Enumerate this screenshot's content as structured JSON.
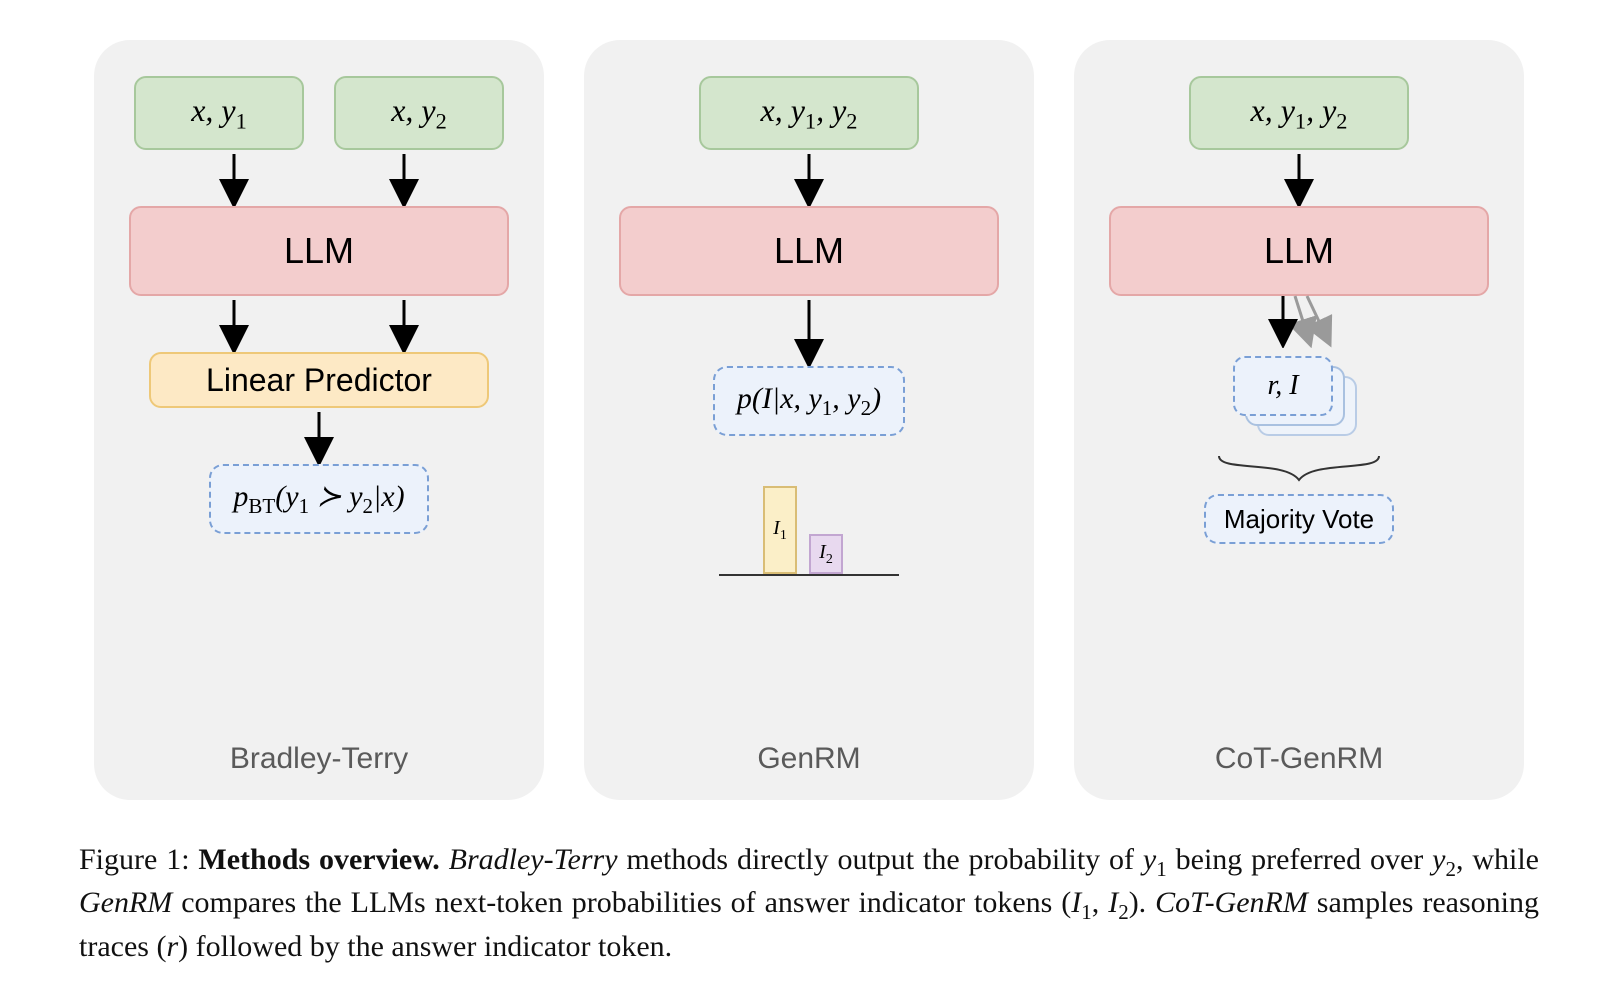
{
  "panels": {
    "bt": {
      "input1_html": "<span class='math'>x, y<sub>1</sub></span>",
      "input2_html": "<span class='math'>x, y<sub>2</sub></span>",
      "llm": "LLM",
      "linear": "Linear Predictor",
      "output_html": "<span class='math'>p<sub>BT</sub>(y<sub>1</sub> ≻ y<sub>2</sub>|x)</span>",
      "label": "Bradley-Terry"
    },
    "genrm": {
      "input_html": "<span class='math'>x, y<sub>1</sub>, y<sub>2</sub></span>",
      "llm": "LLM",
      "output_html": "<span class='math'>p(I|x, y<sub>1</sub>, y<sub>2</sub>)</span>",
      "bar1_html": "<span class='math'>I<sub>1</sub></span>",
      "bar2_html": "<span class='math'>I<sub>2</sub></span>",
      "label": "GenRM"
    },
    "cot": {
      "input_html": "<span class='math'>x, y<sub>1</sub>, y<sub>2</sub></span>",
      "llm": "LLM",
      "sample_html": "<span class='math'>r, I</span>",
      "vote": "Majority Vote",
      "label": "CoT-GenRM"
    }
  },
  "caption_html": "Figure 1: <span class='bold'>Methods overview.</span> <span class='ital'>Bradley-Terry</span> methods directly output the probability of <span class='math'>y<sub>1</sub></span> being preferred over <span class='math'>y<sub>2</sub></span>, while <span class='ital'>GenRM</span> compares the LLMs next-token probabilities of answer indicator tokens (<span class='math'>I<sub>1</sub></span>, <span class='math'>I<sub>2</sub></span>). <span class='ital'>CoT-GenRM</span> samples reasoning traces (<span class='math'>r</span>) followed by the answer indicator token."
}
